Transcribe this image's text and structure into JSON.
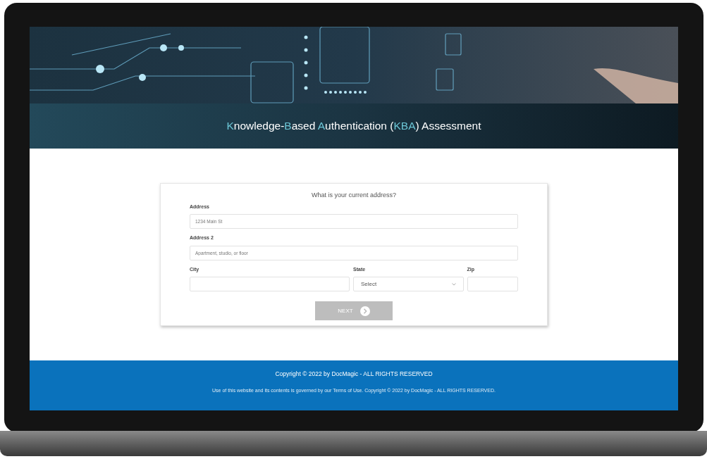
{
  "title": [
    {
      "text": "K",
      "accent": true
    },
    {
      "text": "nowledge-",
      "accent": false
    },
    {
      "text": "B",
      "accent": true
    },
    {
      "text": "ased ",
      "accent": false
    },
    {
      "text": "A",
      "accent": true
    },
    {
      "text": "uthentication (",
      "accent": false
    },
    {
      "text": "KBA",
      "accent": true
    },
    {
      "text": ") Assessment",
      "accent": false
    }
  ],
  "form": {
    "question": "What is your current address?",
    "fields": [
      {
        "label": "Address",
        "placeholder": "1234 Main St",
        "kind": "text"
      },
      {
        "label": "Address 2",
        "placeholder": "Apartment, studio, or floor",
        "kind": "text"
      }
    ],
    "row": [
      {
        "label": "City",
        "kind": "text"
      },
      {
        "label": "State",
        "kind": "select",
        "value": "Select"
      },
      {
        "label": "Zip",
        "kind": "text"
      }
    ],
    "button": {
      "label": "NEXT",
      "disabled": true
    }
  },
  "footer": {
    "copyright": "Copyright © 2022 by DocMagic - ALL RIGHTS RESERVED",
    "notice": "Use of this website and its contents is governed by our Terms of Use. Copyright © 2022 by DocMagic - ALL RIGHTS RESERVED."
  }
}
